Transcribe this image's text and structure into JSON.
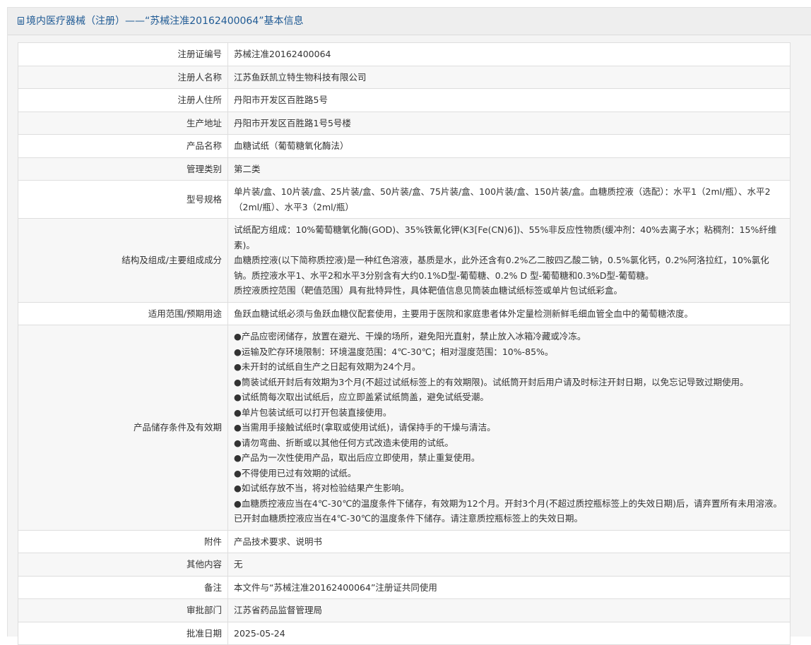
{
  "header": {
    "title": "境内医疗器械（注册）——“苏械注准20162400064”基本信息"
  },
  "rows": [
    {
      "label": "注册证编号",
      "lines": [
        "苏械注准20162400064"
      ]
    },
    {
      "label": "注册人名称",
      "lines": [
        "江苏鱼跃凯立特生物科技有限公司"
      ]
    },
    {
      "label": "注册人住所",
      "lines": [
        "丹阳市开发区百胜路5号"
      ]
    },
    {
      "label": "生产地址",
      "lines": [
        "丹阳市开发区百胜路1号5号楼"
      ]
    },
    {
      "label": "产品名称",
      "lines": [
        "血糖试纸（葡萄糖氧化酶法）"
      ]
    },
    {
      "label": "管理类别",
      "lines": [
        "第二类"
      ]
    },
    {
      "label": "型号规格",
      "lines": [
        "单片装/盒、10片装/盒、25片装/盒、50片装/盒、75片装/盒、100片装/盒、150片装/盒。血糖质控液（选配）：水平1（2ml/瓶）、水平2（2ml/瓶）、水平3（2ml/瓶）"
      ]
    },
    {
      "label": "结构及组成/主要组成成分",
      "lines": [
        "试纸配方组成：10%葡萄糖氧化酶(GOD)、35%铁氰化钾(K3[Fe(CN)6])、55%非反应性物质(缓冲剂：40%去离子水；粘稠剂：15%纤维素)。",
        "血糖质控液(以下简称质控液)是一种红色溶液，基质是水，此外还含有0.2%乙二胺四乙酸二钠，0.5%氯化钙，0.2%阿洛拉红，10%氯化钠。质控液水平1、水平2和水平3分别含有大约0.1%D型-葡萄糖、0.2% D 型-葡萄糖和0.3%D型-葡萄糖。",
        "质控液质控范围（靶值范围）具有批特异性，具体靶值信息见筒装血糖试纸标签或单片包试纸彩盒。"
      ]
    },
    {
      "label": "适用范围/预期用途",
      "lines": [
        "鱼跃血糖试纸必须与鱼跃血糖仪配套使用，主要用于医院和家庭患者体外定量检测新鲜毛细血管全血中的葡萄糖浓度。"
      ]
    },
    {
      "label": "产品储存条件及有效期",
      "lines": [
        "●产品应密闭储存，放置在避光、干燥的场所，避免阳光直射，禁止放入冰箱冷藏或冷冻。",
        "●运输及贮存环境限制：环境温度范围：4℃-30℃；相对湿度范围：10%-85%。",
        "●未开封的试纸自生产之日起有效期为24个月。",
        "●筒装试纸开封后有效期为3个月(不超过试纸标签上的有效期限)。试纸筒开封后用户请及时标注开封日期，以免忘记导致过期使用。",
        "●试纸筒每次取出试纸后，应立即盖紧试纸筒盖，避免试纸受潮。",
        "●单片包装试纸可以打开包装直接使用。",
        "●当需用手接触试纸时(拿取或使用试纸)，请保持手的干燥与清洁。",
        "●请勿弯曲、折断或以其他任何方式改造未使用的试纸。",
        "●产品为一次性使用产品，取出后应立即使用，禁止重复使用。",
        "●不得使用已过有效期的试纸。",
        "●如试纸存放不当，将对检验结果产生影响。",
        "●血糖质控液应当在4℃-30℃的温度条件下储存，有效期为12个月。开封3个月(不超过质控瓶标签上的失效日期)后，请弃置所有未用溶液。已开封血糖质控液应当在4℃-30℃的温度条件下储存。请注意质控瓶标签上的失效日期。"
      ]
    },
    {
      "label": "附件",
      "lines": [
        "产品技术要求、说明书"
      ]
    },
    {
      "label": "其他内容",
      "lines": [
        "无"
      ]
    },
    {
      "label": "备注",
      "lines": [
        "本文件与“苏械注准20162400064”注册证共同使用"
      ]
    },
    {
      "label": "审批部门",
      "lines": [
        "江苏省药品监督管理局"
      ]
    },
    {
      "label": "批准日期",
      "lines": [
        "2025-05-24"
      ]
    }
  ]
}
